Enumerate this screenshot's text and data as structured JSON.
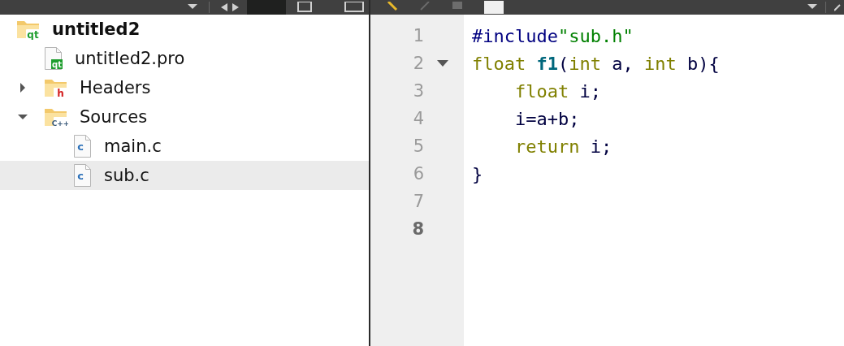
{
  "project_tree": [
    {
      "label": "untitled2",
      "kind": "qt-folder",
      "badge": "qt",
      "active": true,
      "selected": false,
      "children": [
        {
          "label": "untitled2.pro",
          "kind": "qt-file",
          "badge": "qt",
          "active": false,
          "selected": false
        },
        {
          "label": "Headers",
          "kind": "header-folder",
          "badge": "h",
          "active": false,
          "selected": false,
          "expanded": false
        },
        {
          "label": "Sources",
          "kind": "source-folder",
          "badge": "C++",
          "active": false,
          "selected": false,
          "expanded": true,
          "children": [
            {
              "label": "main.c",
              "kind": "c-file",
              "badge": "c",
              "active": false,
              "selected": false
            },
            {
              "label": "sub.c",
              "kind": "c-file",
              "badge": "c",
              "active": false,
              "selected": true
            }
          ]
        }
      ]
    }
  ],
  "editor": {
    "lines": [
      {
        "number": "1",
        "current": false,
        "foldable": false,
        "tokens": [
          {
            "text": "#include",
            "kind": "preprocessor"
          },
          {
            "text": "\"sub.h\"",
            "kind": "string"
          }
        ]
      },
      {
        "number": "2",
        "current": false,
        "foldable": true,
        "tokens": [
          {
            "text": "float ",
            "kind": "keyword"
          },
          {
            "text": "f1",
            "kind": "function"
          },
          {
            "text": "(",
            "kind": "plain"
          },
          {
            "text": "int",
            "kind": "keyword"
          },
          {
            "text": " a, ",
            "kind": "plain"
          },
          {
            "text": "int",
            "kind": "keyword"
          },
          {
            "text": " b){",
            "kind": "plain"
          }
        ]
      },
      {
        "number": "3",
        "current": false,
        "foldable": false,
        "tokens": [
          {
            "text": "    float",
            "kind": "keyword"
          },
          {
            "text": " i;",
            "kind": "plain"
          }
        ]
      },
      {
        "number": "4",
        "current": false,
        "foldable": false,
        "tokens": [
          {
            "text": "    i=a+b;",
            "kind": "plain"
          }
        ]
      },
      {
        "number": "5",
        "current": false,
        "foldable": false,
        "tokens": [
          {
            "text": "    return",
            "kind": "keyword"
          },
          {
            "text": " i;",
            "kind": "plain"
          }
        ]
      },
      {
        "number": "6",
        "current": false,
        "foldable": false,
        "tokens": [
          {
            "text": "}",
            "kind": "plain"
          }
        ]
      },
      {
        "number": "7",
        "current": false,
        "foldable": false
      },
      {
        "number": "8",
        "current": true,
        "foldable": false
      }
    ]
  }
}
